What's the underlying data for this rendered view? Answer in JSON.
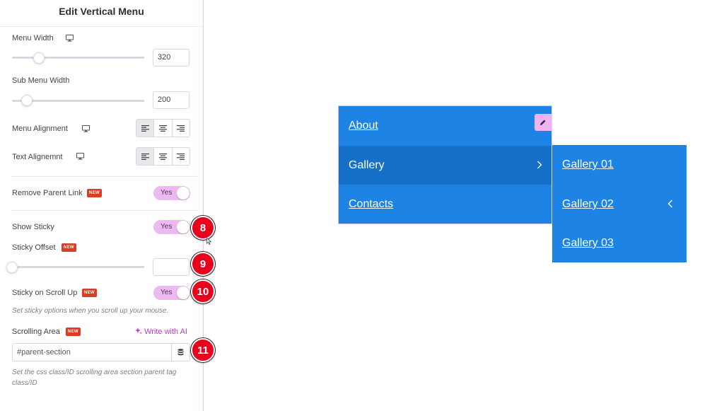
{
  "panel": {
    "title": "Edit Vertical Menu",
    "menu_width": {
      "label": "Menu Width",
      "value": "320",
      "slider_percent": 21
    },
    "sub_menu_width": {
      "label": "Sub Menu Width",
      "value": "200",
      "slider_percent": 11
    },
    "menu_alignment": {
      "label": "Menu Alignment",
      "selected": "left",
      "options": [
        "left",
        "center",
        "right"
      ]
    },
    "text_alignment": {
      "label": "Text Alignemnt",
      "selected": "left",
      "options": [
        "left",
        "center",
        "right"
      ]
    },
    "remove_parent_link": {
      "label": "Remove Parent Link",
      "badge": "NEW",
      "toggle": "Yes"
    },
    "show_sticky": {
      "label": "Show Sticky",
      "toggle": "Yes"
    },
    "sticky_offset": {
      "label": "Sticky Offset",
      "badge": "NEW",
      "value": "",
      "slider_percent": 0
    },
    "sticky_scroll_up": {
      "label": "Sticky on Scroll Up",
      "badge": "NEW",
      "toggle": "Yes",
      "hint": "Set sticky options when you scroll up your mouse."
    },
    "scrolling_area": {
      "label": "Scrolling Area",
      "badge": "NEW",
      "ai_link": "Write with AI",
      "value": "#parent-section",
      "hint": "Set the css class/ID scrolling area section parent tag class/ID"
    }
  },
  "callouts": [
    "8",
    "9",
    "10",
    "11"
  ],
  "preview": {
    "menu_items": [
      {
        "label": "About",
        "state": "link"
      },
      {
        "label": "Gallery",
        "state": "active"
      },
      {
        "label": "Contacts",
        "state": "link"
      }
    ],
    "submenu_items": [
      {
        "label": "Gallery 01"
      },
      {
        "label": "Gallery 02"
      },
      {
        "label": "Gallery 03"
      }
    ]
  },
  "colors": {
    "menu_bg": "#1d84e6",
    "menu_active_bg": "#1670c8",
    "toggle_on": "#ecb9f0",
    "badge_red": "#dd3b24",
    "callout_red": "#e8001c",
    "ai_purple": "#c036c8"
  }
}
